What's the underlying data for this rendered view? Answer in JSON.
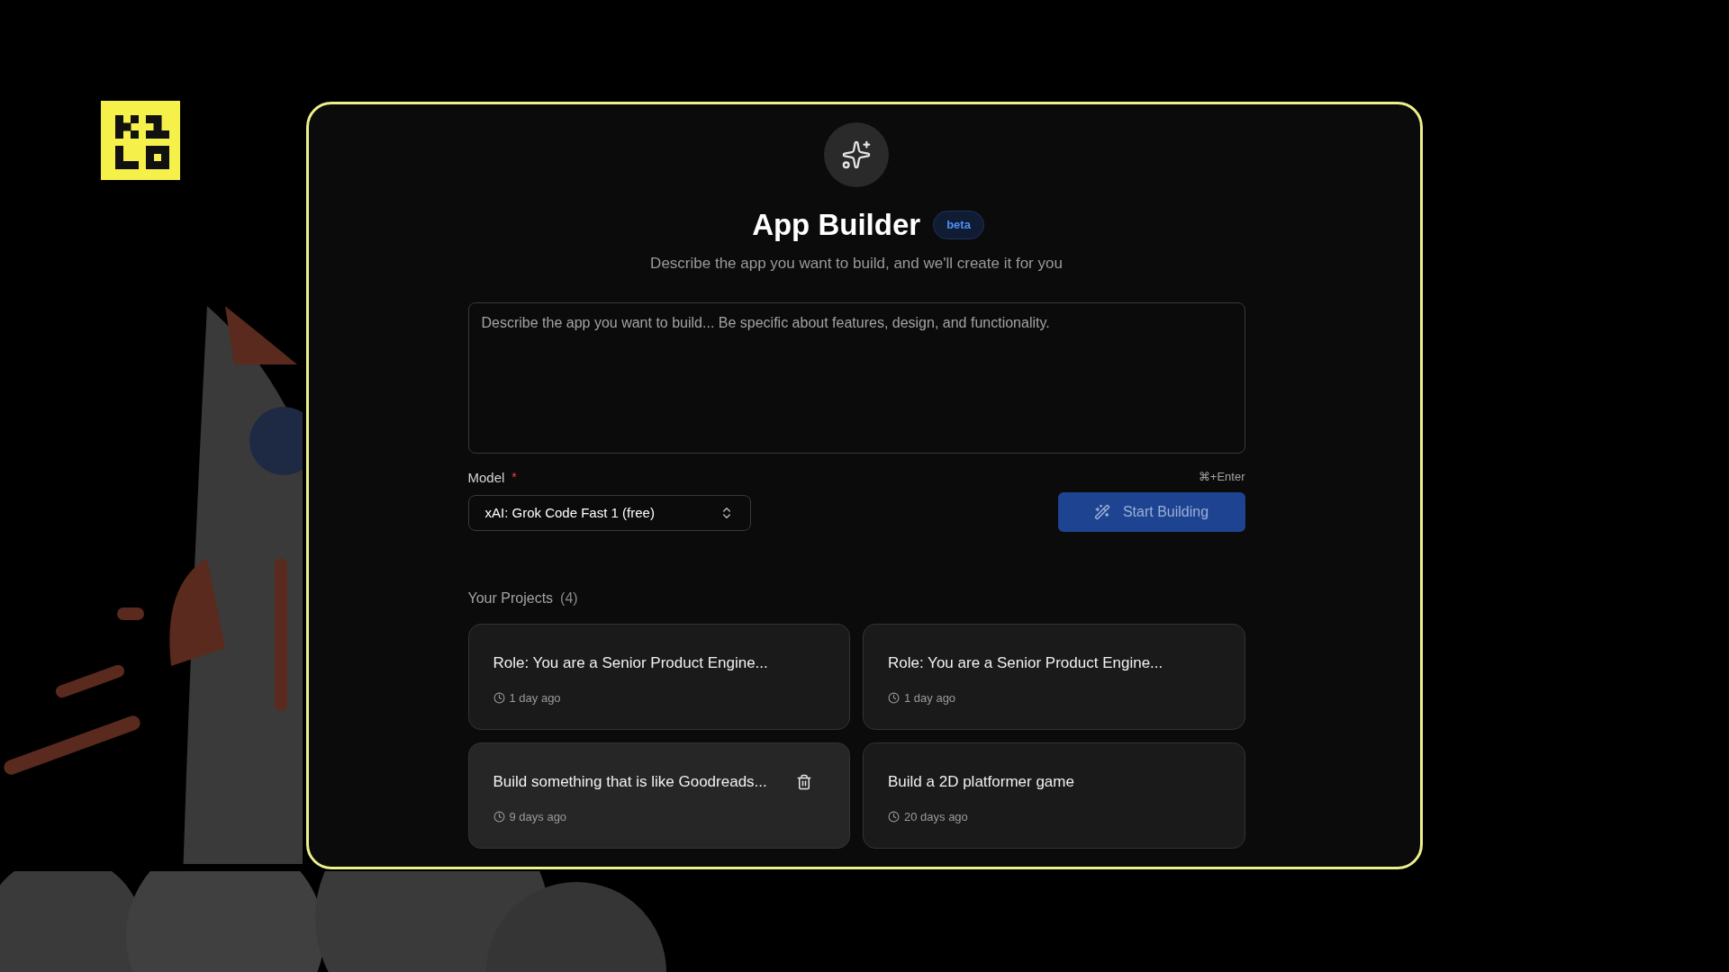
{
  "header": {
    "title": "App Builder",
    "badge": "beta",
    "subtitle": "Describe the app you want to build, and we'll create it for you"
  },
  "prompt": {
    "placeholder": "Describe the app you want to build... Be specific about features, design, and functionality."
  },
  "model": {
    "label": "Model",
    "required_mark": "*",
    "value": "xAI: Grok Code Fast 1 (free)"
  },
  "shortcut": "⌘+Enter",
  "start_button": {
    "label": "Start Building",
    "disabled": true
  },
  "projects": {
    "title": "Your Projects",
    "count": "(4)",
    "items": [
      {
        "title": "Role: You are a Senior Product Engine...",
        "time": "1 day ago",
        "hovered": false
      },
      {
        "title": "Role: You are a Senior Product Engine...",
        "time": "1 day ago",
        "hovered": false
      },
      {
        "title": "Build something that is like Goodreads...",
        "time": "9 days ago",
        "hovered": true
      },
      {
        "title": "Build a 2D platformer game",
        "time": "20 days ago",
        "hovered": false
      }
    ]
  }
}
